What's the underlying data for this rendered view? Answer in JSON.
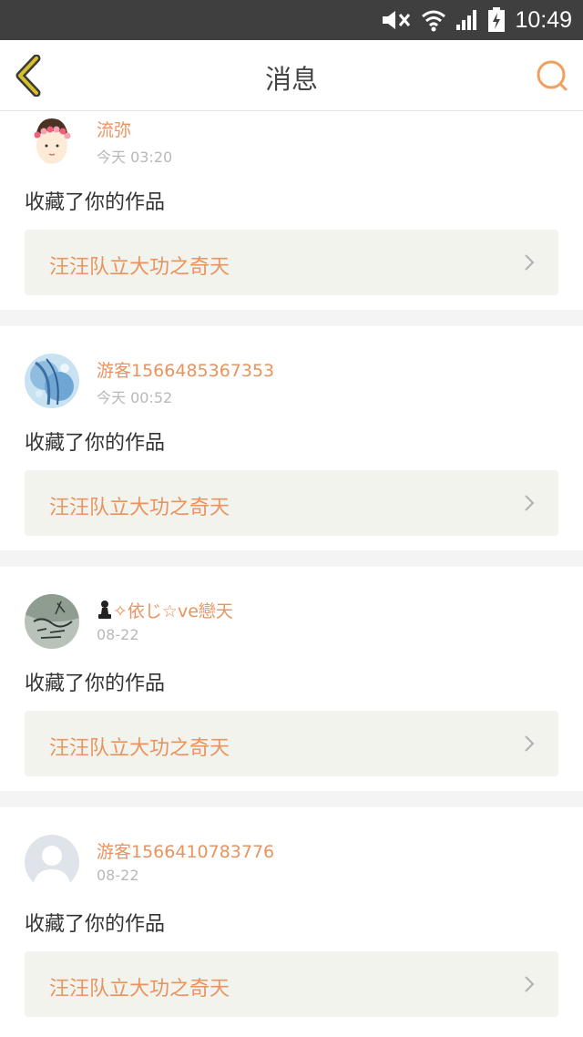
{
  "status_bar": {
    "time": "10:49"
  },
  "header": {
    "title": "消息"
  },
  "colors": {
    "accent": "#e9935e",
    "status_bar": "#3f3f3f",
    "back_icon": "#d6c12a"
  },
  "messages": [
    {
      "username": "流弥",
      "time": "今天 03:20",
      "action": "收藏了你的作品",
      "work_title": "汪汪队立大功之奇天",
      "avatar": "avatar-girl-flower-crown"
    },
    {
      "username": "游客1566485367353",
      "time": "今天 00:52",
      "action": "收藏了你的作品",
      "work_title": "汪汪队立大功之奇天",
      "avatar": "avatar-anime-blue"
    },
    {
      "username": "✧依じ☆ve戀天",
      "username_prefix_icon": "chess-pawn-icon",
      "time": "08-22",
      "action": "收藏了你的作品",
      "work_title": "汪汪队立大功之奇天",
      "avatar": "avatar-calligraphy"
    },
    {
      "username": "游客1566410783776",
      "time": "08-22",
      "action": "收藏了你的作品",
      "work_title": "汪汪队立大功之奇天",
      "avatar": "avatar-default-person"
    }
  ]
}
